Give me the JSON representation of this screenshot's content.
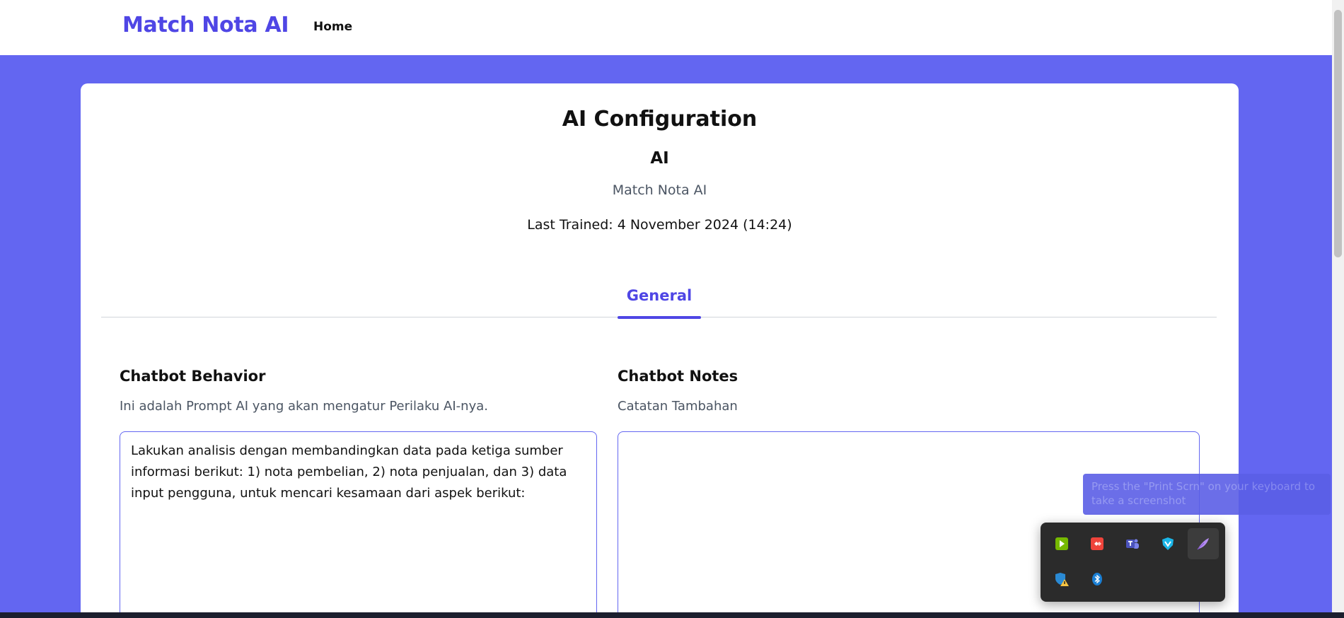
{
  "navbar": {
    "brand": "Match Nota AI",
    "home_link": "Home"
  },
  "config": {
    "title": "AI Configuration",
    "ai_name": "AI",
    "ai_subtitle": "Match Nota AI",
    "last_trained": "Last Trained: 4 November 2024 (14:24)"
  },
  "tabs": [
    {
      "label": "General",
      "active": true
    }
  ],
  "behavior": {
    "title": "Chatbot Behavior",
    "description": "Ini adalah Prompt AI yang akan mengatur Perilaku AI-nya.",
    "value": "Lakukan analisis dengan membandingkan data pada ketiga sumber informasi berikut: 1) nota pembelian, 2) nota penjualan, dan 3) data input pengguna, untuk mencari kesamaan dari aspek berikut:"
  },
  "notes": {
    "title": "Chatbot Notes",
    "description": "Catatan Tambahan",
    "value": ""
  },
  "toast": {
    "message": "Press the \"Print Scrn\" on your keyboard to take a screenshot"
  },
  "tray": {
    "icons": [
      "nvidia-icon",
      "anydesk-icon",
      "teams-icon",
      "vpn-icon",
      "feather-icon",
      "defender-warning-icon",
      "bluetooth-icon"
    ]
  },
  "colors": {
    "accent": "#4f46e5",
    "background": "#6366f1",
    "tray_bg": "#2b2b2b"
  }
}
